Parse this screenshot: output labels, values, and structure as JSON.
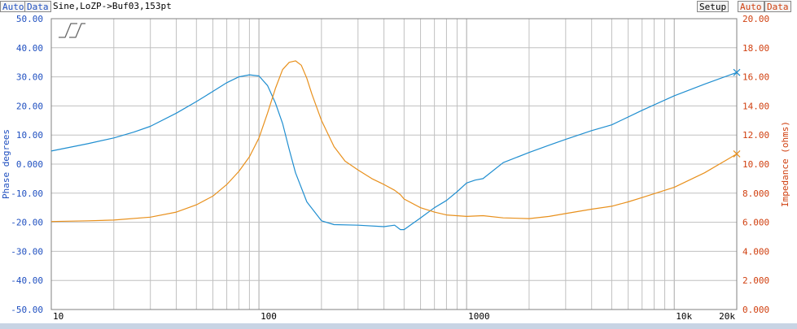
{
  "toolbar": {
    "left_auto": "Auto",
    "left_data": "Data",
    "trace_title": "Sine,LoZP->Buf03,153pt",
    "setup": "Setup",
    "right_auto": "Auto",
    "right_data": "Data"
  },
  "colors": {
    "phase": "#1f8ed0",
    "impedance": "#e8901c",
    "left_axis_text": "#2050c0",
    "right_axis_text": "#d04010",
    "grid": "#c0c0c0"
  },
  "chart_data": {
    "type": "line",
    "x_scale": "log",
    "xlim": [
      10,
      20000
    ],
    "x_ticks": [
      {
        "value": 10,
        "label": "10"
      },
      {
        "value": 100,
        "label": "100"
      },
      {
        "value": 1000,
        "label": "1000"
      },
      {
        "value": 10000,
        "label": "10k"
      },
      {
        "value": 20000,
        "label": "20k"
      }
    ],
    "y_left": {
      "label": "Phase degrees",
      "lim": [
        -50,
        50
      ],
      "ticks": [
        "-50.00",
        "-40.00",
        "-30.00",
        "-20.00",
        "-10.00",
        "0.000",
        "10.00",
        "20.00",
        "30.00",
        "40.00",
        "50.00"
      ],
      "tick_values": [
        -50,
        -40,
        -30,
        -20,
        -10,
        0,
        10,
        20,
        30,
        40,
        50
      ]
    },
    "y_right": {
      "label": "Impedance (ohms)",
      "lim": [
        0,
        20
      ],
      "ticks": [
        "0.000",
        "2.000",
        "4.000",
        "6.000",
        "8.000",
        "10.00",
        "12.00",
        "14.00",
        "16.00",
        "18.00",
        "20.00"
      ],
      "tick_values": [
        0,
        2,
        4,
        6,
        8,
        10,
        12,
        14,
        16,
        18,
        20
      ]
    },
    "grid": true,
    "series": [
      {
        "axis": "left",
        "color": "#1f8ed0",
        "x": [
          10,
          15,
          20,
          25,
          30,
          40,
          50,
          60,
          70,
          80,
          90,
          100,
          110,
          120,
          130,
          140,
          150,
          170,
          200,
          230,
          300,
          400,
          450,
          480,
          500,
          600,
          700,
          800,
          900,
          1000,
          1100,
          1200,
          1500,
          2000,
          2500,
          3000,
          4000,
          5000,
          7000,
          10000,
          14000,
          20000
        ],
        "y": [
          4.5,
          7.0,
          9.0,
          11.0,
          13.0,
          17.5,
          21.5,
          25.0,
          28.0,
          30.0,
          30.7,
          30.3,
          27.0,
          21.0,
          14.0,
          5.0,
          -3.0,
          -13.0,
          -19.5,
          -20.8,
          -21.0,
          -21.5,
          -21.0,
          -22.5,
          -22.5,
          -18.5,
          -15.0,
          -12.5,
          -9.5,
          -6.5,
          -5.5,
          -5.0,
          0.5,
          4.0,
          6.5,
          8.5,
          11.5,
          13.5,
          18.5,
          23.5,
          27.5,
          31.5
        ]
      },
      {
        "axis": "right",
        "color": "#e8901c",
        "x": [
          10,
          15,
          20,
          30,
          40,
          50,
          60,
          70,
          80,
          90,
          100,
          110,
          120,
          130,
          140,
          150,
          160,
          170,
          180,
          200,
          230,
          260,
          300,
          350,
          400,
          450,
          480,
          500,
          600,
          700,
          800,
          1000,
          1200,
          1500,
          2000,
          2500,
          3000,
          4000,
          5000,
          6000,
          7000,
          10000,
          14000,
          20000
        ],
        "y": [
          6.05,
          6.1,
          6.15,
          6.35,
          6.7,
          7.2,
          7.8,
          8.6,
          9.5,
          10.5,
          11.8,
          13.5,
          15.2,
          16.5,
          17.0,
          17.1,
          16.8,
          15.9,
          14.8,
          13.0,
          11.2,
          10.2,
          9.6,
          9.0,
          8.6,
          8.2,
          7.9,
          7.6,
          7.0,
          6.7,
          6.5,
          6.4,
          6.45,
          6.3,
          6.25,
          6.4,
          6.6,
          6.9,
          7.1,
          7.4,
          7.7,
          8.4,
          9.4,
          10.7
        ]
      }
    ]
  }
}
